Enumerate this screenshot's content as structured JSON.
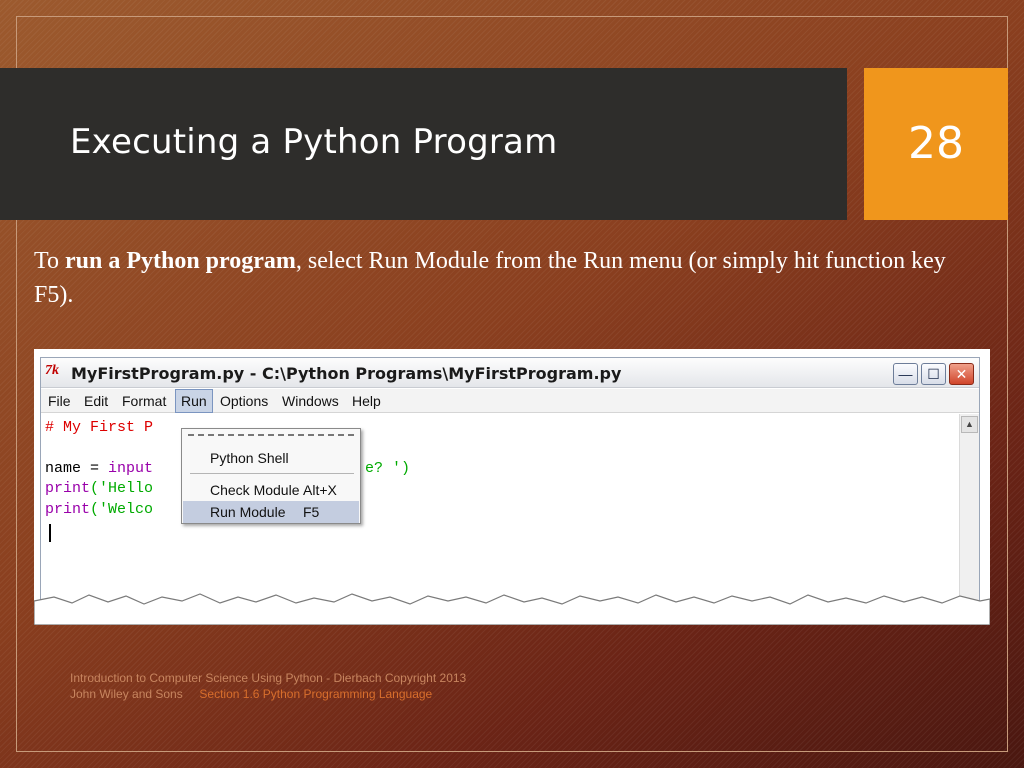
{
  "slide": {
    "title": "Executing a Python Program",
    "number": "28",
    "body_pre": "To ",
    "body_bold": "run a Python program",
    "body_post": ", select Run Module from the Run menu (or simply hit function key F5).",
    "footer_line1": "Introduction to Computer Science Using Python - Dierbach      Copyright 2013",
    "footer_line2_a": "John Wiley and  Sons ",
    "footer_line2_b": "Section 1.6  Python Programming Language"
  },
  "window": {
    "icon": "7k",
    "title": "MyFirstProgram.py - C:\\Python Programs\\MyFirstProgram.py",
    "buttons": {
      "minimize": "—",
      "maximize": "☐",
      "close": "✕"
    },
    "menu": [
      "File",
      "Edit",
      "Format",
      "Run",
      "Options",
      "Windows",
      "Help"
    ],
    "active_menu": "Run"
  },
  "code": {
    "line1": "# My First P",
    "line2_a": "name = ",
    "line2_b": "input",
    "line2_c": "e? ')",
    "line3_a": "print",
    "line3_b": "('Hello",
    "line4_a": "print",
    "line4_b": "('Welco"
  },
  "run_menu": {
    "items": [
      {
        "label": "Python Shell",
        "accel": ""
      },
      {
        "label": "Check Module",
        "accel": "Alt+X"
      },
      {
        "label": "Run Module",
        "accel": "F5"
      }
    ],
    "highlighted": "Run Module"
  },
  "colors": {
    "title_bar": "#2e2d2b",
    "number_box": "#f0961c",
    "comment": "#dd0000",
    "builtin": "#9900aa",
    "string": "#00aa00"
  }
}
